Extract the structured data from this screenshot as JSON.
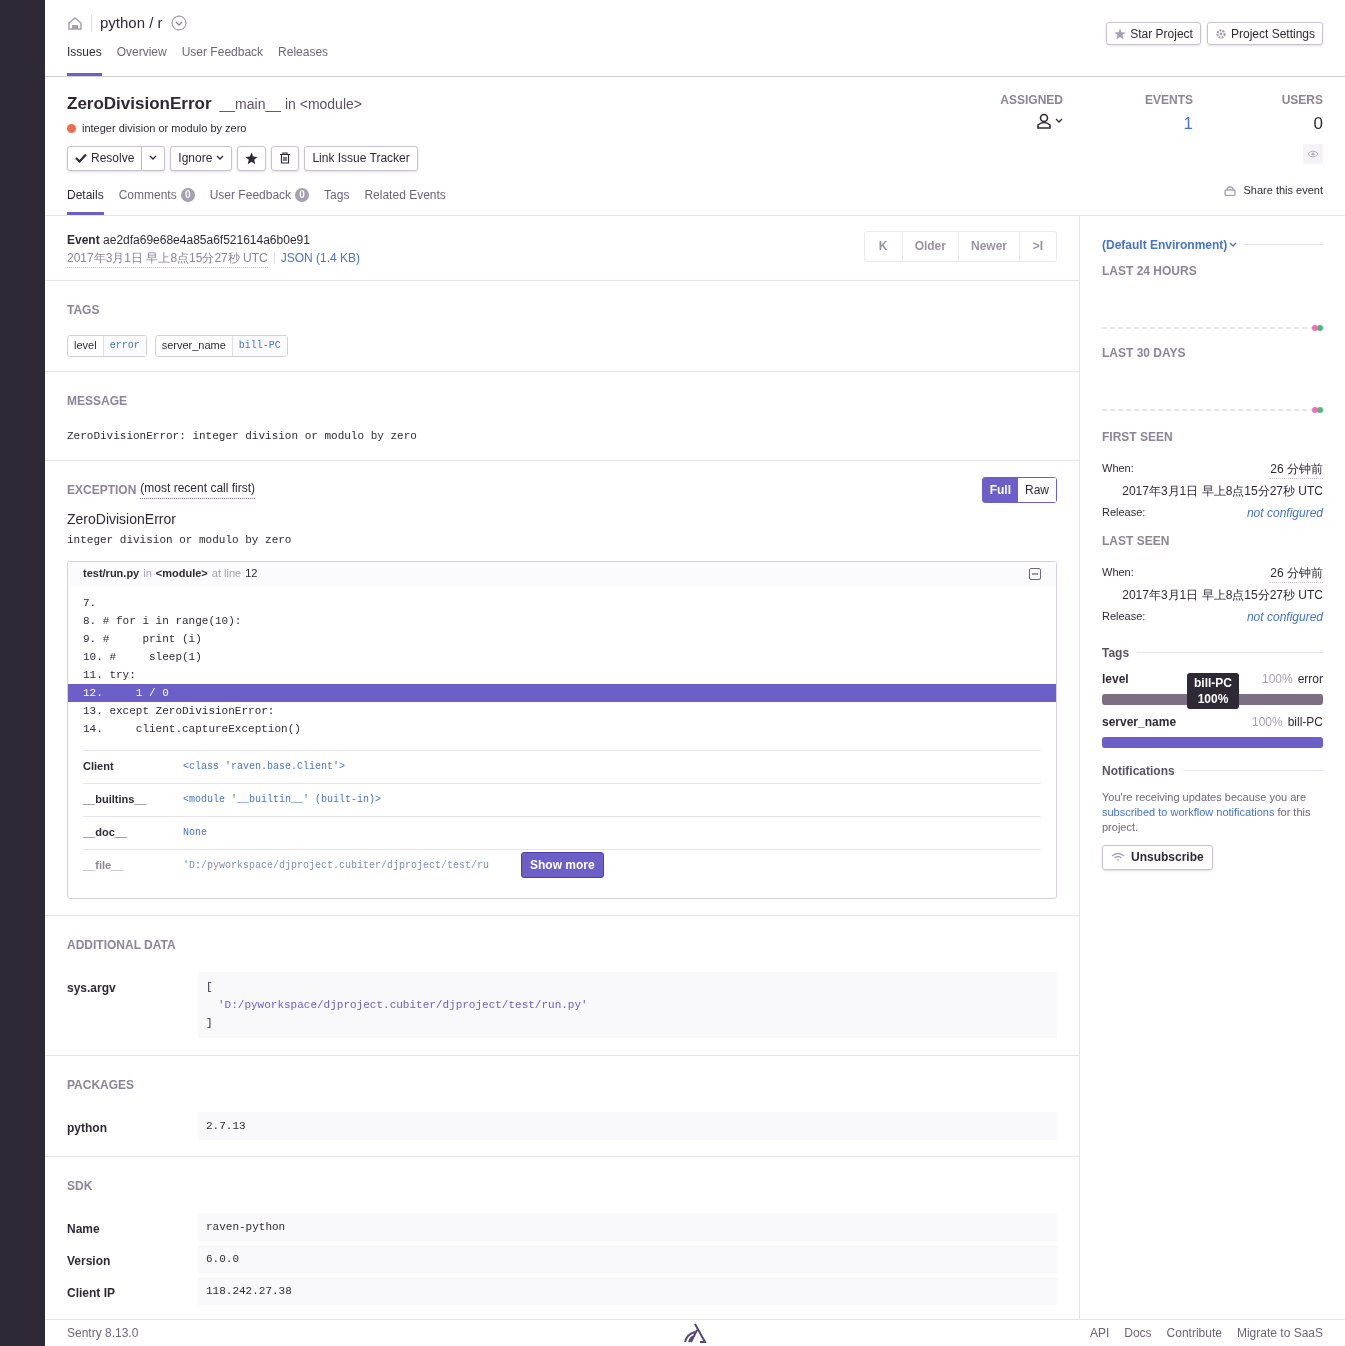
{
  "project": {
    "title": "python / r"
  },
  "nav_tabs": [
    {
      "label": "Issues",
      "selected": true
    },
    {
      "label": "Overview",
      "selected": false
    },
    {
      "label": "User Feedback",
      "selected": false
    },
    {
      "label": "Releases",
      "selected": false
    }
  ],
  "header_buttons": [
    "Star Project",
    "Project Settings"
  ],
  "issue": {
    "title": "ZeroDivisionError",
    "culprit": "__main__ in <module>",
    "message": "integer division or modulo by zero"
  },
  "actions": {
    "resolve": "Resolve",
    "ignore": "Ignore",
    "link": "Link Issue Tracker"
  },
  "stats": [
    {
      "label": "ASSIGNED",
      "kind": "assignee"
    },
    {
      "label": "EVENTS",
      "kind": "link",
      "value": "1"
    },
    {
      "label": "USERS",
      "kind": "plain",
      "value": "0"
    }
  ],
  "detail_tabs": [
    {
      "label": "Details",
      "selected": true
    },
    {
      "label": "Comments",
      "count": "0",
      "selected": false
    },
    {
      "label": "User Feedback",
      "count": "0",
      "selected": false
    },
    {
      "label": "Tags",
      "selected": false
    },
    {
      "label": "Related Events",
      "selected": false
    }
  ],
  "share": "Share this event",
  "event": {
    "label": "Event",
    "id": "ae2dfa69e68e4a85a6f521614a6b0e91",
    "date": "2017年3月1日 早上8点15分27秒 UTC",
    "json": "JSON (1.4 KB)"
  },
  "pager": [
    {
      "label": "K",
      "kind": "icon"
    },
    {
      "label": "Older",
      "kind": "text"
    },
    {
      "label": "Newer",
      "kind": "text"
    },
    {
      "label": ">I",
      "kind": "icon"
    }
  ],
  "tags_section": {
    "heading": "TAGS",
    "tags": [
      {
        "key": "level",
        "value": "error"
      },
      {
        "key": "server_name",
        "value": "bill-PC"
      }
    ]
  },
  "message_section": {
    "heading": "MESSAGE",
    "text": "ZeroDivisionError: integer division or modulo by zero"
  },
  "exception": {
    "heading": "EXCEPTION",
    "note": "(most recent call first)",
    "modes": [
      {
        "label": "Full",
        "selected": true
      },
      {
        "label": "Raw",
        "selected": false
      }
    ],
    "type": "ZeroDivisionError",
    "value": "integer division or modulo by zero",
    "frame": {
      "file": "test/run.py",
      "in": "in",
      "function": "<module>",
      "at": "at line",
      "line": "12"
    },
    "code": [
      {
        "text": "7.",
        "selected": false
      },
      {
        "text": "8. # for i in range(10):",
        "selected": false
      },
      {
        "text": "9. #     print (i)",
        "selected": false
      },
      {
        "text": "10. #     sleep(1)",
        "selected": false
      },
      {
        "text": "11. try:",
        "selected": false
      },
      {
        "text": "12.     1 / 0",
        "selected": true
      },
      {
        "text": "13. except ZeroDivisionError:",
        "selected": false
      },
      {
        "text": "14.     client.captureException()",
        "selected": false
      }
    ],
    "vars": [
      {
        "key": "Client",
        "value": "<class 'raven.base.Client'>",
        "faded": false
      },
      {
        "key": "__builtins__",
        "value": "<module '__builtin__' (built-in)>",
        "faded": false
      },
      {
        "key": "__doc__",
        "value": "None",
        "faded": false
      },
      {
        "key": "__file__",
        "value": "'D:/pyworkspace/djproject.cubiter/djproject/test/ru",
        "faded": true
      }
    ],
    "show_more": "Show more"
  },
  "additional": {
    "heading": "ADDITIONAL DATA",
    "rows": [
      {
        "key": "sys.argv",
        "lines": [
          "[",
          "'D:/pyworkspace/djproject.cubiter/djproject/test/run.py'",
          "]"
        ]
      }
    ]
  },
  "packages": {
    "heading": "PACKAGES",
    "rows": [
      {
        "key": "python",
        "lines": [
          "2.7.13"
        ]
      }
    ]
  },
  "sdk": {
    "heading": "SDK",
    "rows": [
      {
        "key": "Name",
        "lines": [
          "raven-python"
        ]
      },
      {
        "key": "Version",
        "lines": [
          "6.0.0"
        ]
      },
      {
        "key": "Client IP",
        "lines": [
          "118.242.27.38"
        ]
      }
    ]
  },
  "sidebar": {
    "environment": "(Default Environment)",
    "last24": "LAST 24 HOURS",
    "last30": "LAST 30 DAYS",
    "seen": [
      {
        "heading": "FIRST SEEN",
        "when_label": "When:",
        "ago": "26 分钟前",
        "date": "2017年3月1日 早上8点15分27秒 UTC",
        "release_label": "Release:",
        "release": "not configured"
      },
      {
        "heading": "LAST SEEN",
        "when_label": "When:",
        "ago": "26 分钟前",
        "date": "2017年3月1日 早上8点15分27秒 UTC",
        "release_label": "Release:",
        "release": "not configured"
      }
    ],
    "tags_heading": "Tags",
    "tag_bars": [
      {
        "key": "level",
        "percent": "100%",
        "value": "error",
        "level": 1,
        "color": "#7c6f83"
      },
      {
        "key": "server_name",
        "percent": "100%",
        "value": "bill-PC",
        "level": 1,
        "color": "#6c5fc7"
      }
    ],
    "tooltip": {
      "title": "bill-PC",
      "value": "100%"
    },
    "notifications_heading": "Notifications",
    "notice": "You're receiving updates because you are",
    "notice_link": "subscribed to workflow notifications",
    "notice_end": "for this project.",
    "unsubscribe": "Unsubscribe"
  },
  "footer": {
    "version": "Sentry 8.13.0",
    "links": [
      "API",
      "Docs",
      "Contribute",
      "Migrate to SaaS"
    ]
  }
}
